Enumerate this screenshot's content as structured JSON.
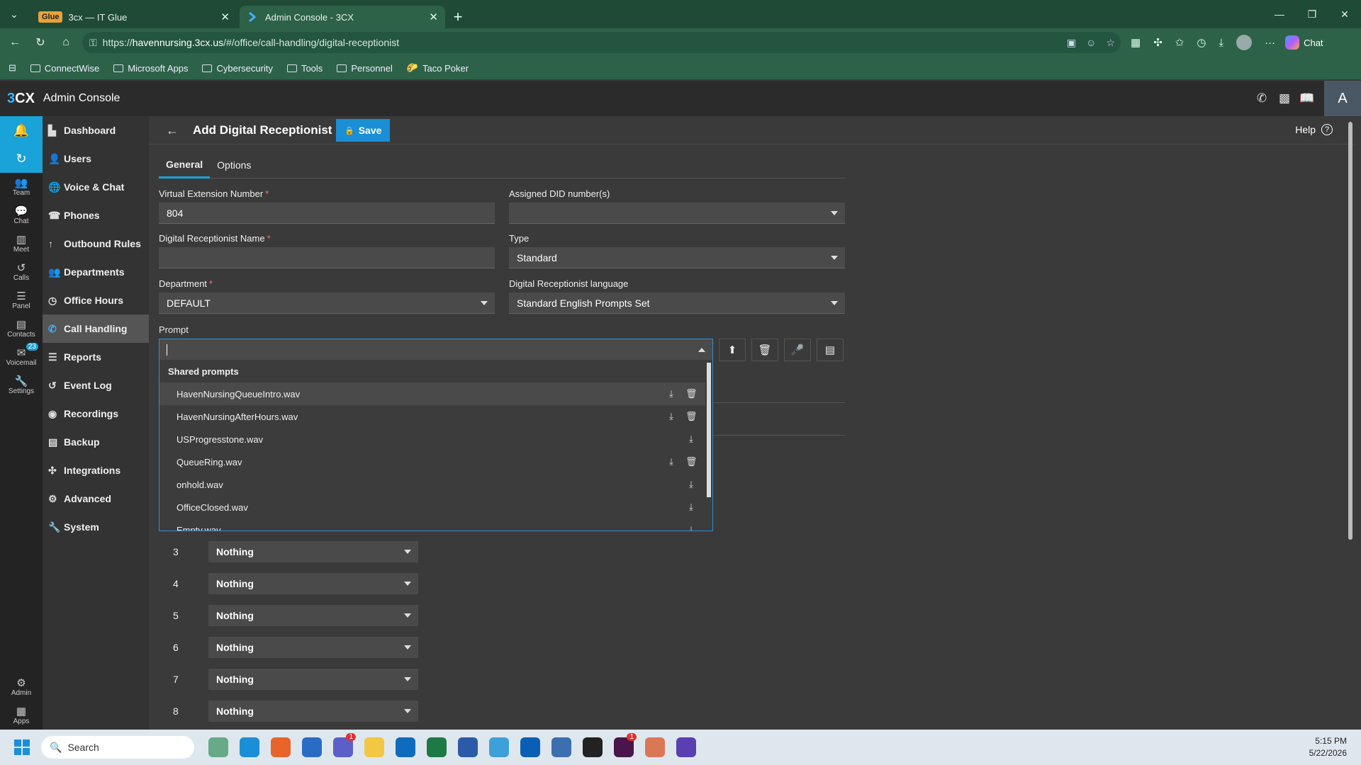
{
  "browser": {
    "tabs": [
      {
        "label": "3cx — IT Glue",
        "badge": "Glue",
        "active": false
      },
      {
        "label": "Admin Console - 3CX",
        "active": true
      }
    ],
    "url_prefix": "https://",
    "url_host": "havennursing.3cx.us",
    "url_path": "/#/office/call-handling/digital-receptionist",
    "chat_label": "Chat",
    "bookmarks": [
      "ConnectWise",
      "Microsoft Apps",
      "Cybersecurity",
      "Tools",
      "Personnel",
      "Taco Poker"
    ]
  },
  "app": {
    "logo": "3CX",
    "title": "Admin Console",
    "avatar": "A"
  },
  "rail": [
    {
      "label": "Team",
      "icon": "team-icon"
    },
    {
      "label": "Chat",
      "icon": "chat-icon"
    },
    {
      "label": "Meet",
      "icon": "meet-icon"
    },
    {
      "label": "Calls",
      "icon": "calls-icon"
    },
    {
      "label": "Panel",
      "icon": "panel-icon"
    },
    {
      "label": "Contacts",
      "icon": "contacts-icon"
    },
    {
      "label": "Voicemail",
      "icon": "voicemail-icon",
      "badge": "23"
    },
    {
      "label": "Settings",
      "icon": "settings-icon"
    },
    {
      "label": "Admin",
      "icon": "admin-icon"
    },
    {
      "label": "Apps",
      "icon": "apps-icon"
    }
  ],
  "sidebar": [
    "Dashboard",
    "Users",
    "Voice & Chat",
    "Phones",
    "Outbound Rules",
    "Departments",
    "Office Hours",
    "Call Handling",
    "Reports",
    "Event Log",
    "Recordings",
    "Backup",
    "Integrations",
    "Advanced",
    "System"
  ],
  "sidebar_active": "Call Handling",
  "page": {
    "title": "Add Digital Receptionist",
    "save_label": "Save",
    "help_label": "Help",
    "tabs": [
      "General",
      "Options"
    ],
    "fields": {
      "ext_label": "Virtual Extension Number",
      "ext_value": "804",
      "did_label": "Assigned DID number(s)",
      "did_value": "",
      "name_label": "Digital Receptionist Name",
      "name_value": "",
      "type_label": "Type",
      "type_value": "Standard",
      "dept_label": "Department",
      "dept_value": "DEFAULT",
      "lang_label": "Digital Receptionist language",
      "lang_value": "Standard English Prompts Set",
      "prompt_label": "Prompt"
    },
    "prompt_dropdown": {
      "group": "Shared prompts",
      "items": [
        {
          "name": "HavenNursingQueueIntro.wav",
          "deletable": true
        },
        {
          "name": "HavenNursingAfterHours.wav",
          "deletable": true
        },
        {
          "name": "USProgresstone.wav",
          "deletable": false
        },
        {
          "name": "QueueRing.wav",
          "deletable": true
        },
        {
          "name": "onhold.wav",
          "deletable": false
        },
        {
          "name": "OfficeClosed.wav",
          "deletable": false
        },
        {
          "name": "Empty.wav",
          "deletable": false
        }
      ]
    },
    "menu_options": [
      {
        "key": "3",
        "action": "Nothing"
      },
      {
        "key": "4",
        "action": "Nothing"
      },
      {
        "key": "5",
        "action": "Nothing"
      },
      {
        "key": "6",
        "action": "Nothing"
      },
      {
        "key": "7",
        "action": "Nothing"
      },
      {
        "key": "8",
        "action": "Nothing"
      }
    ]
  },
  "taskbar": {
    "search_placeholder": "Search",
    "time": "5:15 PM",
    "date": "5/22/2026"
  }
}
